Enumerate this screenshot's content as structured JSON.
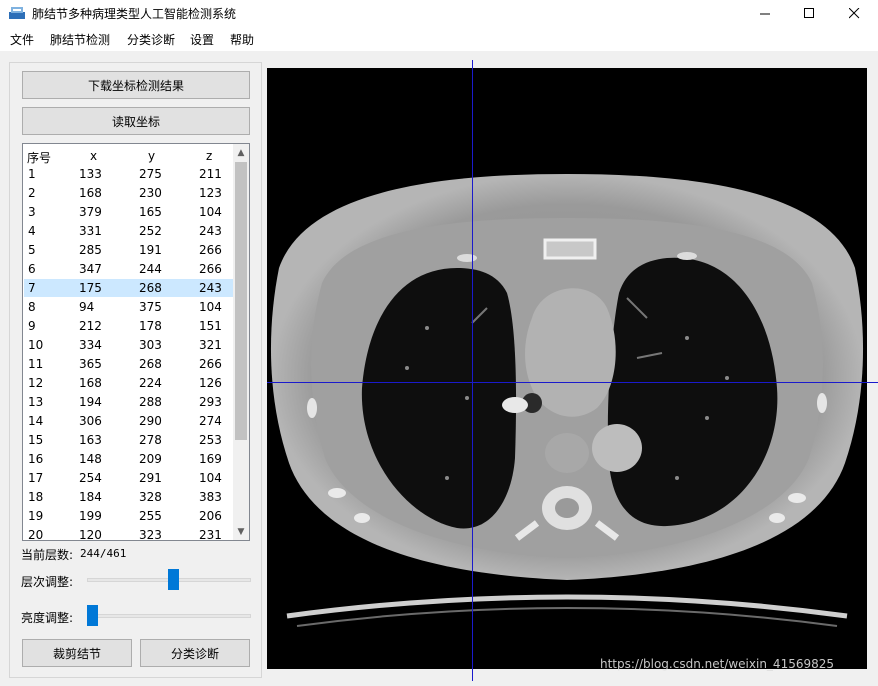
{
  "window": {
    "title": "肺结节多种病理类型人工智能检测系统",
    "minimize": "—",
    "maximize": "☐",
    "close": "✕"
  },
  "menu": {
    "items": [
      "文件",
      "肺结节检测",
      "分类诊断",
      "设置",
      "帮助"
    ]
  },
  "buttons": {
    "download": "下载坐标检测结果",
    "read": "读取坐标",
    "crop": "裁剪结节",
    "classify": "分类诊断"
  },
  "table": {
    "headers": [
      "序号",
      "x",
      "y",
      "z"
    ],
    "rows": [
      [
        "1",
        "133",
        "275",
        "211"
      ],
      [
        "2",
        "168",
        "230",
        "123"
      ],
      [
        "3",
        "379",
        "165",
        "104"
      ],
      [
        "4",
        "331",
        "252",
        "243"
      ],
      [
        "5",
        "285",
        "191",
        "266"
      ],
      [
        "6",
        "347",
        "244",
        "266"
      ],
      [
        "7",
        "175",
        "268",
        "243"
      ],
      [
        "8",
        "94",
        "375",
        "104"
      ],
      [
        "9",
        "212",
        "178",
        "151"
      ],
      [
        "10",
        "334",
        "303",
        "321"
      ],
      [
        "11",
        "365",
        "268",
        "266"
      ],
      [
        "12",
        "168",
        "224",
        "126"
      ],
      [
        "13",
        "194",
        "288",
        "293"
      ],
      [
        "14",
        "306",
        "290",
        "274"
      ],
      [
        "15",
        "163",
        "278",
        "253"
      ],
      [
        "16",
        "148",
        "209",
        "169"
      ],
      [
        "17",
        "254",
        "291",
        "104"
      ],
      [
        "18",
        "184",
        "328",
        "383"
      ],
      [
        "19",
        "199",
        "255",
        "206"
      ],
      [
        "20",
        "120",
        "323",
        "231"
      ]
    ],
    "selected_row": 7
  },
  "layer": {
    "label": "当前层数:",
    "value": "244/461"
  },
  "sliders": {
    "level_label": "层次调整:",
    "level_value": 0.53,
    "brightness_label": "亮度调整:",
    "brightness_value": 0.0
  },
  "viewer": {
    "crosshair_color": "#1a1acc",
    "watermark": "https://blog.csdn.net/weixin_41569825"
  },
  "colors": {
    "accent": "#0078d7",
    "selection": "#cce8ff"
  }
}
